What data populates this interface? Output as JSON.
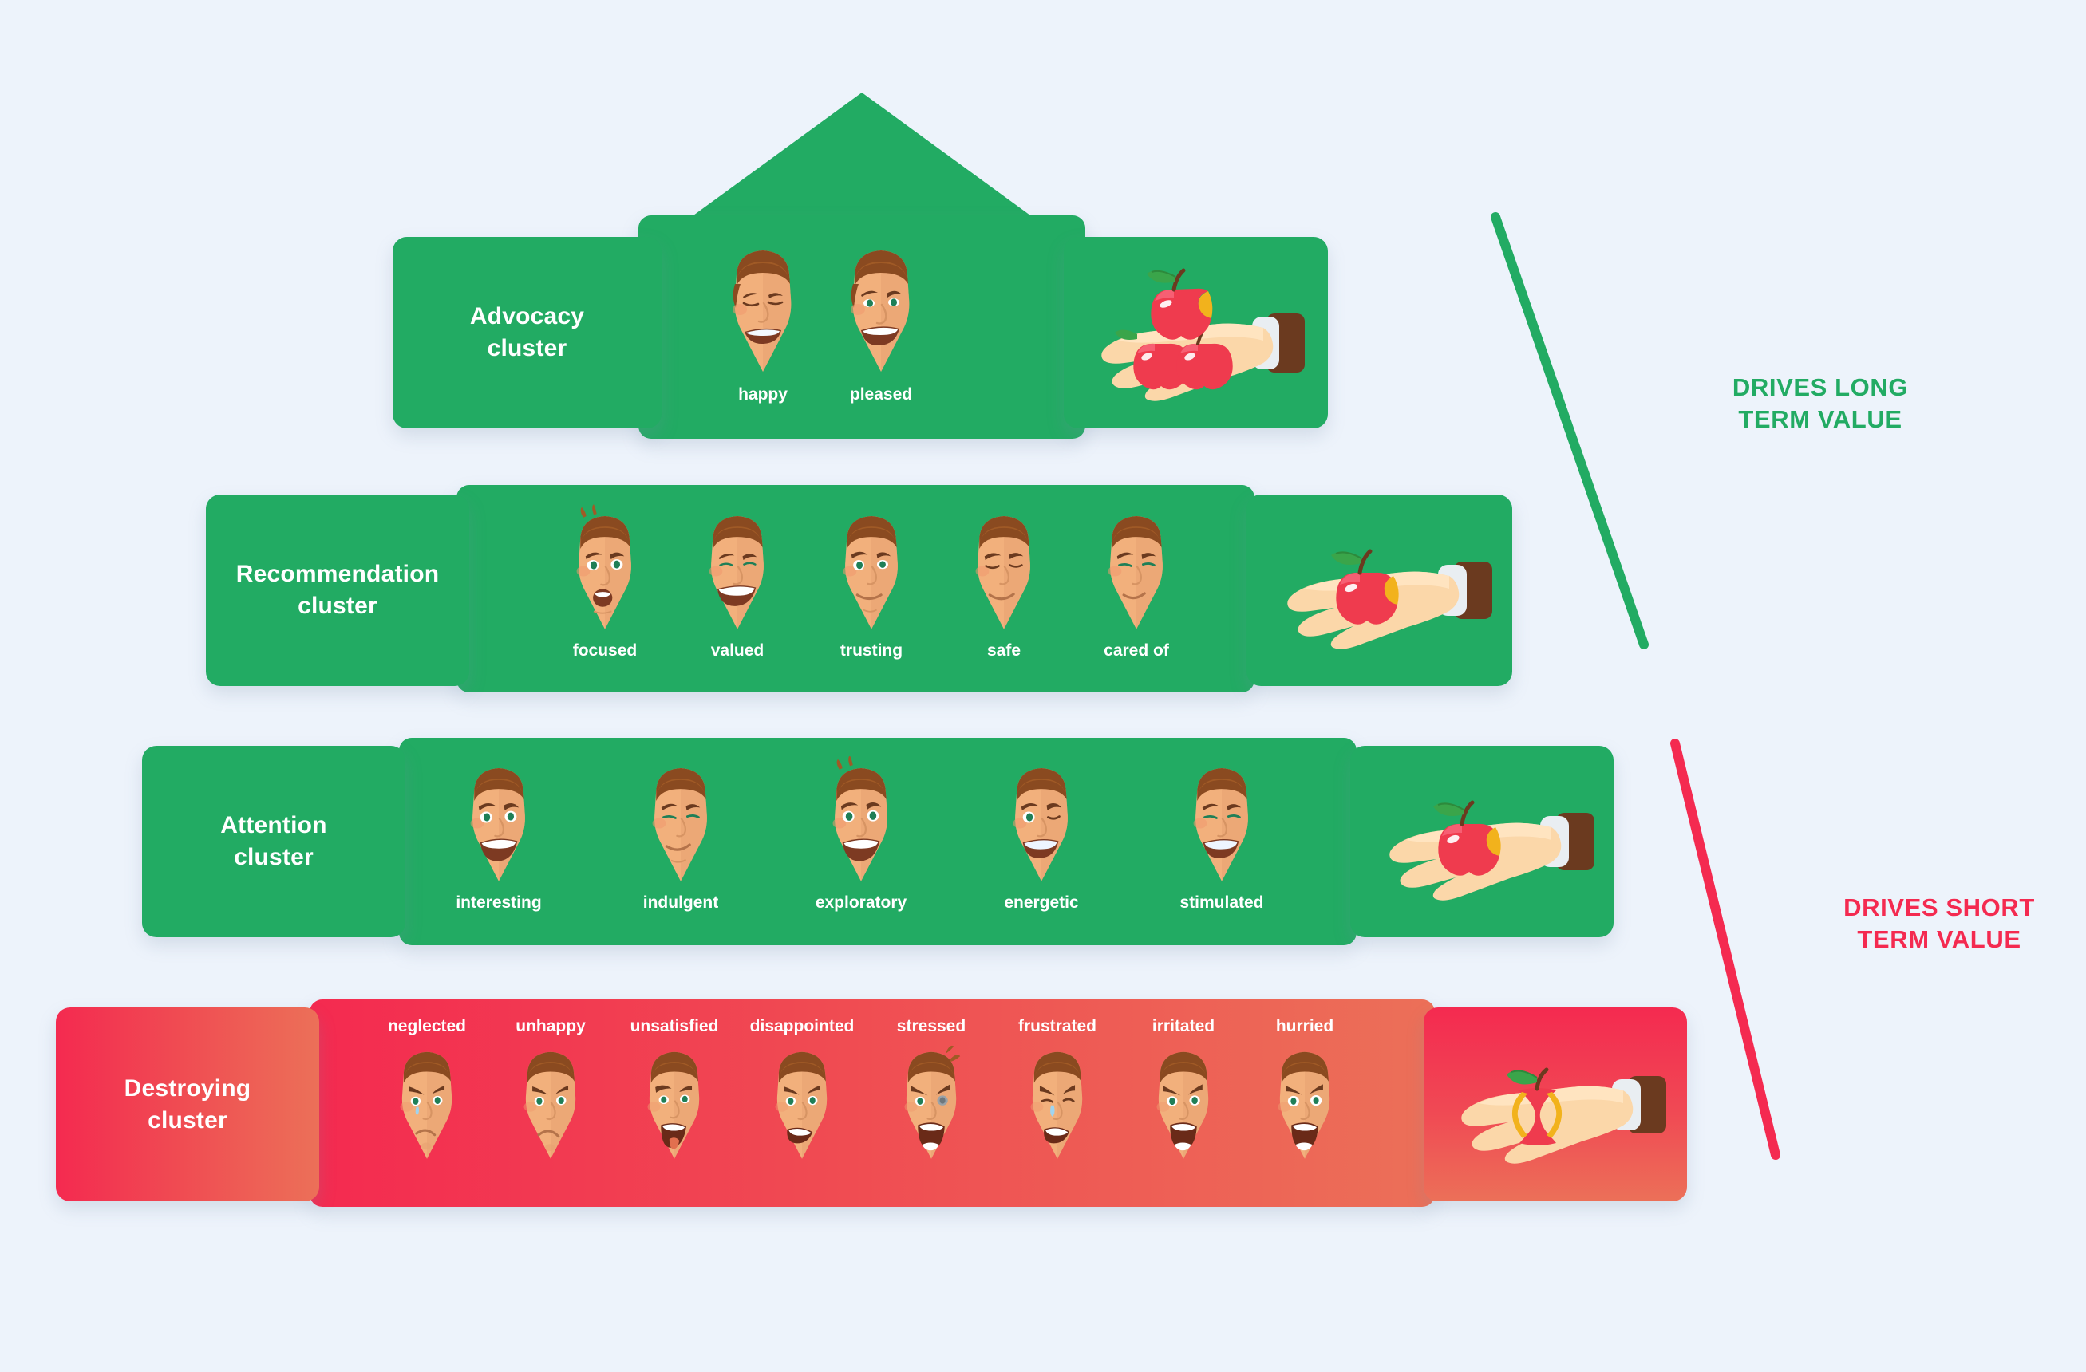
{
  "background_color": "#edf3fb",
  "colors": {
    "green": "#22ab63",
    "red_start": "#f42a50",
    "red_end": "#ec7058",
    "label_text": "#ffffff"
  },
  "clusters": [
    {
      "id": "advocacy",
      "title_line1": "Advocacy",
      "title_line2": "cluster",
      "tone": "green",
      "caption_position": "below",
      "emotions": [
        {
          "label": "happy",
          "mood": "smile-closed-eyes"
        },
        {
          "label": "pleased",
          "mood": "smile-open"
        }
      ],
      "reward_icon": "hand-holding-three-apples"
    },
    {
      "id": "recommendation",
      "title_line1": "Recommendation",
      "title_line2": "cluster",
      "tone": "green",
      "caption_position": "below",
      "emotions": [
        {
          "label": "focused",
          "mood": "open-mouth-wide-eyes"
        },
        {
          "label": "valued",
          "mood": "big-teeth-smile"
        },
        {
          "label": "trusting",
          "mood": "soft-smile-eyes-open"
        },
        {
          "label": "safe",
          "mood": "content-closed-eyes"
        },
        {
          "label": "cared of",
          "mood": "calm-half-eyes"
        }
      ],
      "reward_icon": "hand-holding-whole-apple"
    },
    {
      "id": "attention",
      "title_line1": "Attention",
      "title_line2": "cluster",
      "tone": "green",
      "caption_position": "below",
      "emotions": [
        {
          "label": "interesting",
          "mood": "open-smile-wide-eyes"
        },
        {
          "label": "indulgent",
          "mood": "smirk-half-eyes"
        },
        {
          "label": "exploratory",
          "mood": "grin-wide-eyes"
        },
        {
          "label": "energetic",
          "mood": "wink-grin"
        },
        {
          "label": "stimulated",
          "mood": "laugh-half-eyes"
        }
      ],
      "reward_icon": "hand-holding-whole-apple"
    },
    {
      "id": "destroying",
      "title_line1": "Destroying",
      "title_line2": "cluster",
      "tone": "red",
      "caption_position": "above",
      "emotions": [
        {
          "label": "neglected",
          "mood": "sad-tear"
        },
        {
          "label": "unhappy",
          "mood": "sad-frown"
        },
        {
          "label": "unsatisfied",
          "mood": "shout-tongue"
        },
        {
          "label": "disappointed",
          "mood": "grimace"
        },
        {
          "label": "stressed",
          "mood": "angry-shout-bruise"
        },
        {
          "label": "frustrated",
          "mood": "crying-grimace"
        },
        {
          "label": "irritated",
          "mood": "angry-shout"
        },
        {
          "label": "hurried",
          "mood": "panic-shout"
        }
      ],
      "reward_icon": "hand-holding-apple-core"
    }
  ],
  "annotations": [
    {
      "id": "long-term",
      "line1": "DRIVES LONG",
      "line2": "TERM VALUE",
      "color": "#22ab63"
    },
    {
      "id": "short-term",
      "line1": "DRIVES SHORT",
      "line2": "TERM VALUE",
      "color": "#f42a50"
    }
  ]
}
